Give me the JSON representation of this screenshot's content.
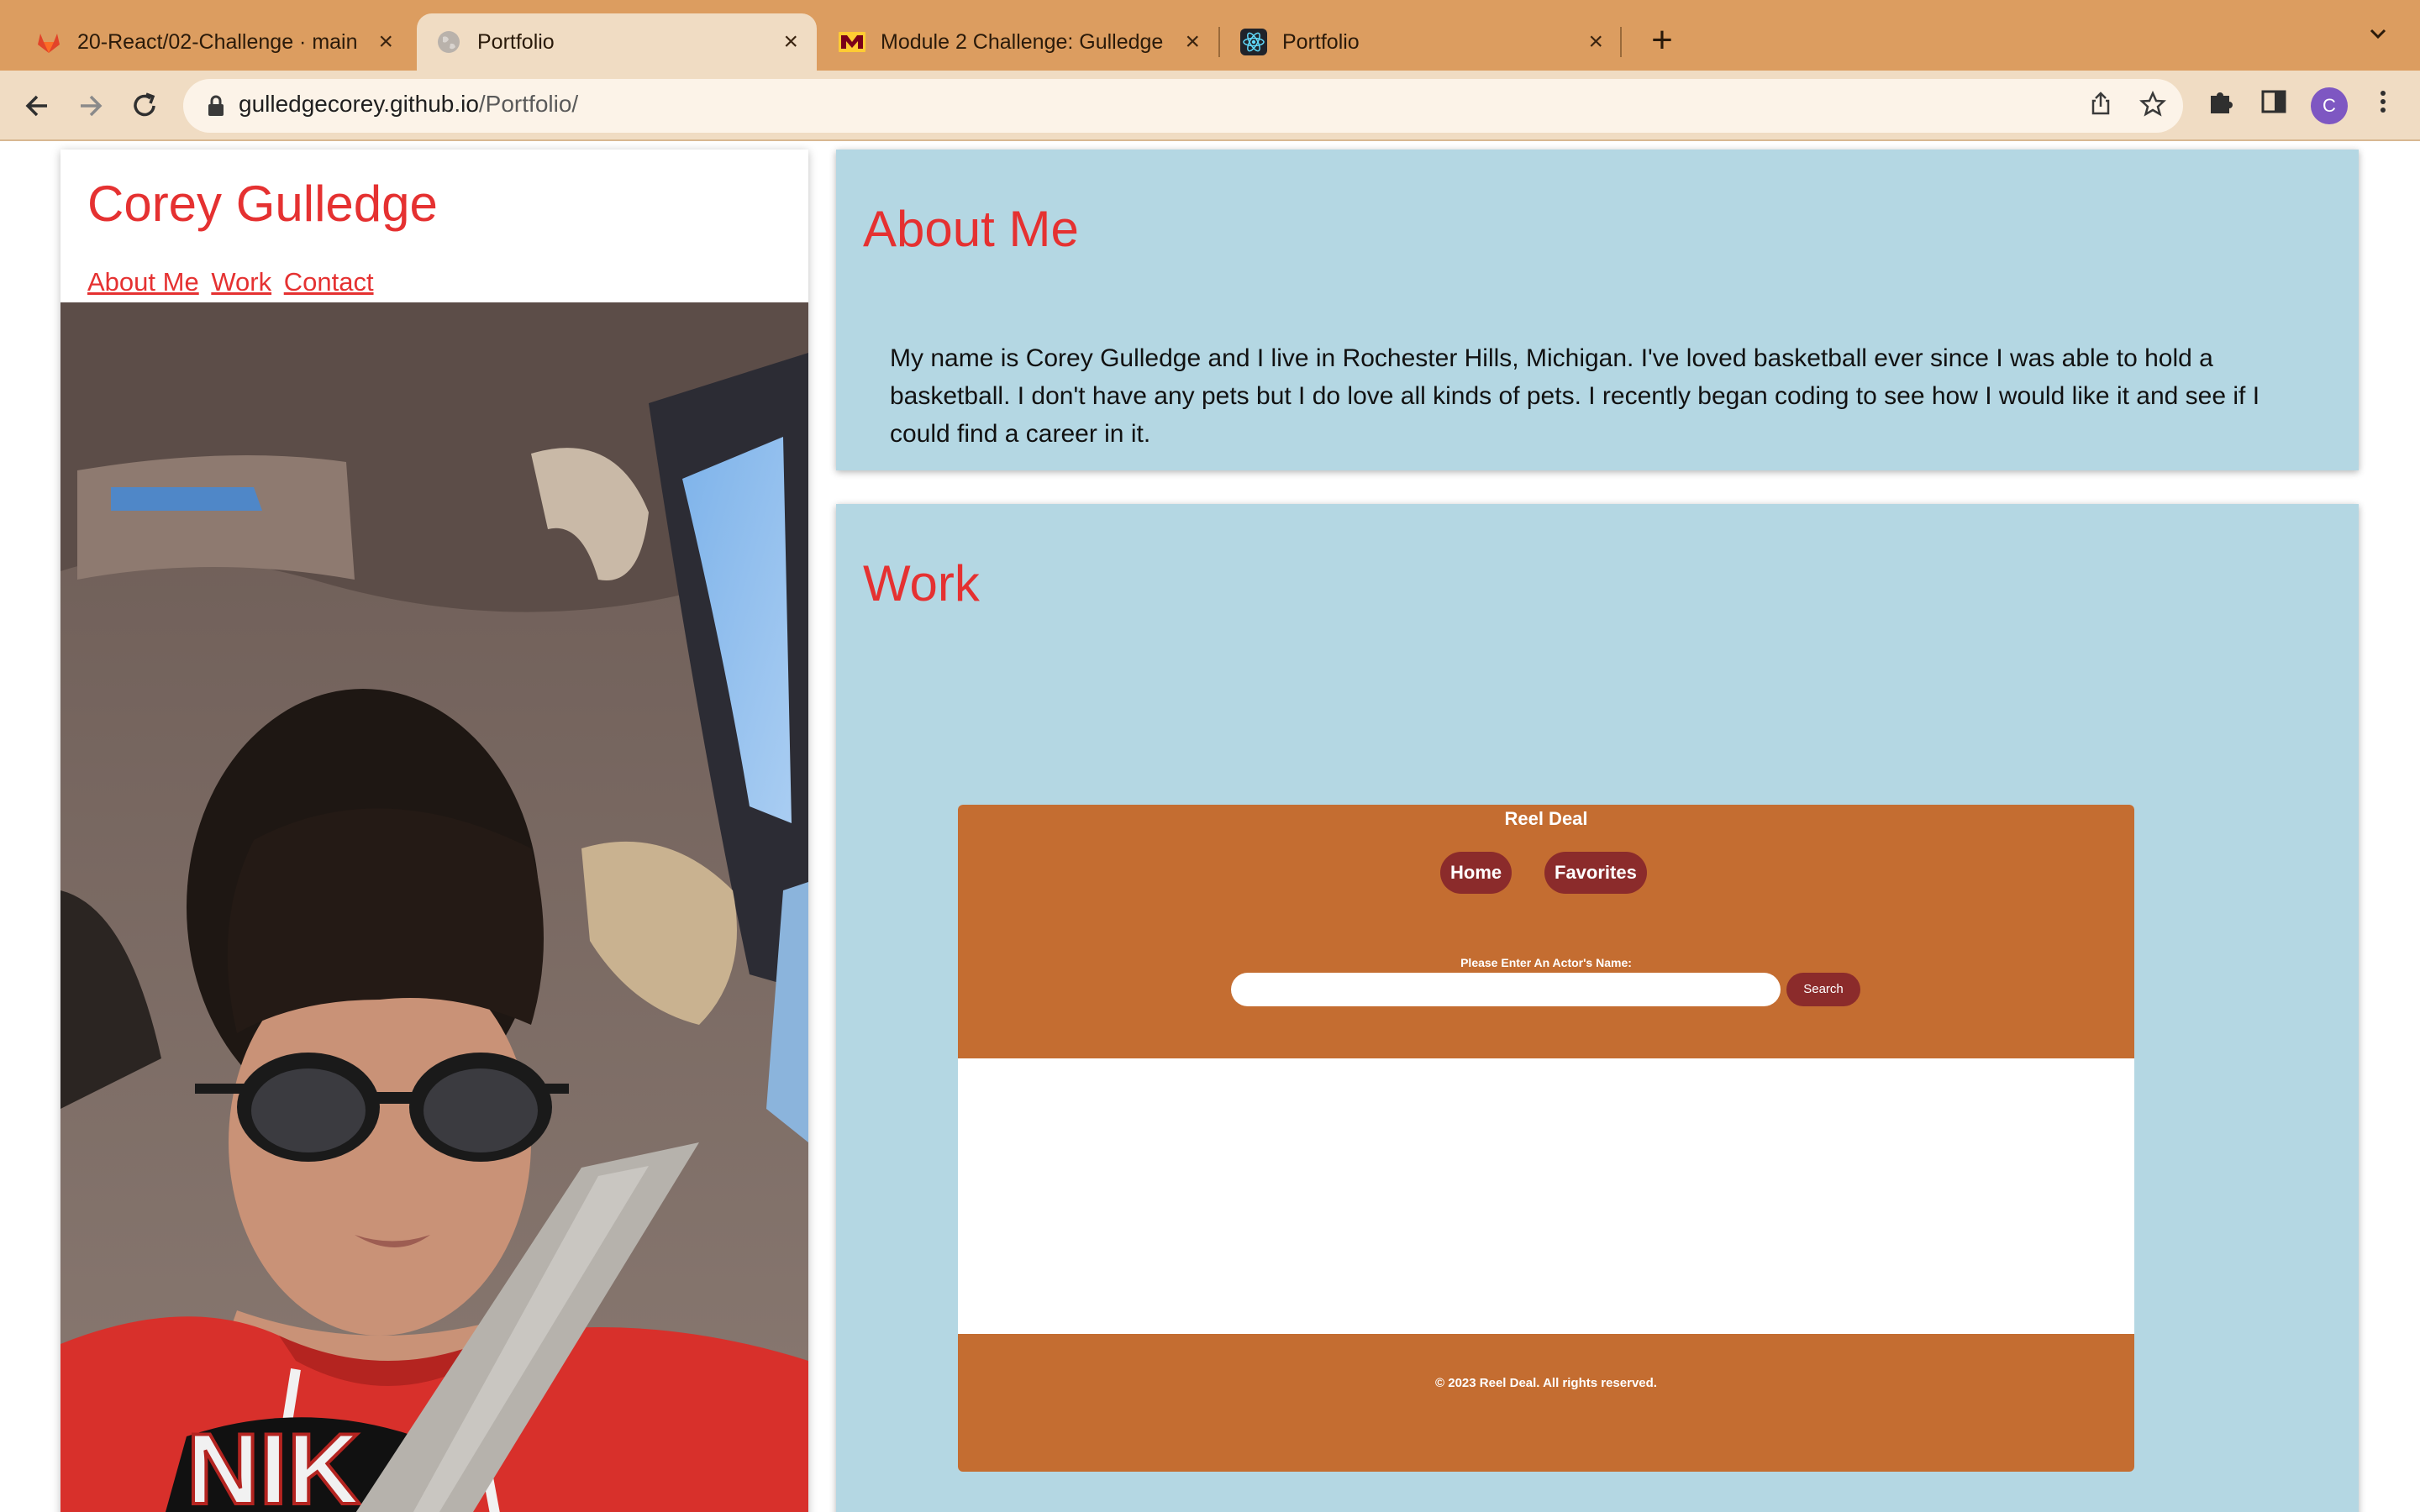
{
  "browser": {
    "tabs": [
      {
        "title": "20-React/02-Challenge · main",
        "favicon": "gitlab-icon",
        "active": false
      },
      {
        "title": "Portfolio",
        "favicon": "globe-icon",
        "active": true
      },
      {
        "title": "Module 2 Challenge: Gulledge",
        "favicon": "university-m-icon",
        "active": false
      },
      {
        "title": "Portfolio",
        "favicon": "react-icon",
        "active": false
      }
    ],
    "close_glyph": "×",
    "new_tab_glyph": "+",
    "url_host": "gulledgecorey.github.io",
    "url_path": "/Portfolio/",
    "profile_initial": "C",
    "colors": {
      "tabstrip": "#dc9d60",
      "toolbar": "#f0dcc3",
      "omnibox": "#fcf3e8",
      "avatar": "#7e57c2"
    }
  },
  "sidebar": {
    "name": "Corey Gulledge",
    "links": [
      "About Me",
      "Work",
      "Contact"
    ],
    "photo": "selfie-photo"
  },
  "about": {
    "heading": "About Me",
    "text": "My name is Corey Gulledge and I live in Rochester Hills, Michigan. I've loved basketball ever since I was able to hold a basketball. I don't have any pets but I do love all kinds of pets. I recently began coding to see how I would like it and see if I could find a career in it."
  },
  "work": {
    "heading": "Work",
    "project": {
      "title": "Reel Deal",
      "nav": [
        "Home",
        "Favorites"
      ],
      "search_label": "Please Enter An Actor's Name:",
      "search_value": "",
      "search_button": "Search",
      "footer": "© 2023 Reel Deal. All rights reserved.",
      "colors": {
        "header": "#c46d31",
        "button": "#8b2b2b"
      }
    }
  },
  "colors": {
    "accent": "#e53131",
    "section_bg": "#b4d7e3"
  }
}
